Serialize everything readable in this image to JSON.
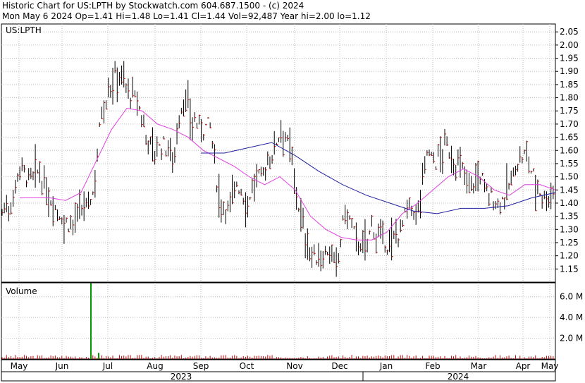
{
  "header": {
    "line1": "Historic Chart for US:LPTH by Stockwatch.com 604.687.1500 - (c) 2024",
    "line2": "Mon May  6 2024  Op=1.41  Hi=1.48  Lo=1.41  Cl=1.44  Vol=92,487  Year hi=2.00  lo=1.12"
  },
  "colors": {
    "price_bar": "#000000",
    "close_tick": "#cc0000",
    "ma_short": "#e040e0",
    "ma_long": "#2020a0",
    "volume": "#009900",
    "grid": "#bbbbbb"
  },
  "chart_data": [
    {
      "type": "line",
      "symbol_label": "US:LPTH",
      "ylim": [
        1.1,
        2.08
      ],
      "yticks": [
        "2.05",
        "2.00",
        "1.95",
        "1.90",
        "1.85",
        "1.80",
        "1.75",
        "1.70",
        "1.65",
        "1.60",
        "1.55",
        "1.50",
        "1.45",
        "1.40",
        "1.35",
        "1.30",
        "1.25",
        "1.20",
        "1.15"
      ],
      "months": [
        "May",
        "Jun",
        "Jul",
        "Aug",
        "Sep",
        "Oct",
        "Nov",
        "Dec",
        "Jan",
        "Feb",
        "Mar",
        "Apr",
        "May"
      ],
      "years": [
        "2023",
        "2024"
      ],
      "grid": true,
      "x": [
        "2023-05",
        "2023-06",
        "2023-07",
        "2023-08",
        "2023-09",
        "2023-10",
        "2023-11",
        "2023-12",
        "2024-01",
        "2024-02",
        "2024-03",
        "2024-04",
        "2024-05"
      ],
      "series": [
        {
          "role": "daily high-low range",
          "anchor_close": [
            1.37,
            1.4,
            1.55,
            1.48,
            1.52,
            1.43,
            1.38,
            1.32,
            1.33,
            1.38,
            1.42,
            1.75,
            1.85,
            1.9,
            1.82,
            1.78,
            1.65,
            1.6,
            1.62,
            1.58,
            1.8,
            1.72,
            1.68,
            1.7,
            1.42,
            1.38,
            1.48,
            1.4,
            1.48,
            1.52,
            1.6,
            1.7,
            1.58,
            1.35,
            1.22,
            1.18,
            1.22,
            1.15,
            1.38,
            1.28,
            1.22,
            1.32,
            1.25,
            1.24,
            1.3,
            1.38,
            1.36,
            1.6,
            1.55,
            1.62,
            1.56,
            1.52,
            1.48,
            1.5,
            1.42,
            1.4,
            1.45,
            1.55,
            1.58,
            1.48,
            1.42,
            1.44
          ]
        },
        {
          "role": "short moving average",
          "values": [
            1.42,
            1.42,
            1.42,
            1.41,
            1.44,
            1.56,
            1.68,
            1.76,
            1.75,
            1.7,
            1.68,
            1.65,
            1.6,
            1.57,
            1.54,
            1.5,
            1.47,
            1.5,
            1.45,
            1.35,
            1.3,
            1.27,
            1.26,
            1.26,
            1.29,
            1.36,
            1.4,
            1.45,
            1.5,
            1.53,
            1.5,
            1.45,
            1.43,
            1.47,
            1.47,
            1.45
          ]
        },
        {
          "role": "long moving average",
          "values": [
            1.59,
            1.59,
            1.61,
            1.63,
            1.58,
            1.52,
            1.47,
            1.43,
            1.4,
            1.37,
            1.36,
            1.38,
            1.38,
            1.39,
            1.42,
            1.44
          ]
        }
      ]
    },
    {
      "type": "bar",
      "title": "Volume",
      "yticks": [
        "6.0 M",
        "4.0 M",
        "2.0 M"
      ],
      "ylim": [
        0,
        7.0
      ],
      "spike": {
        "month": "2023-07",
        "value": 7.3
      }
    }
  ]
}
